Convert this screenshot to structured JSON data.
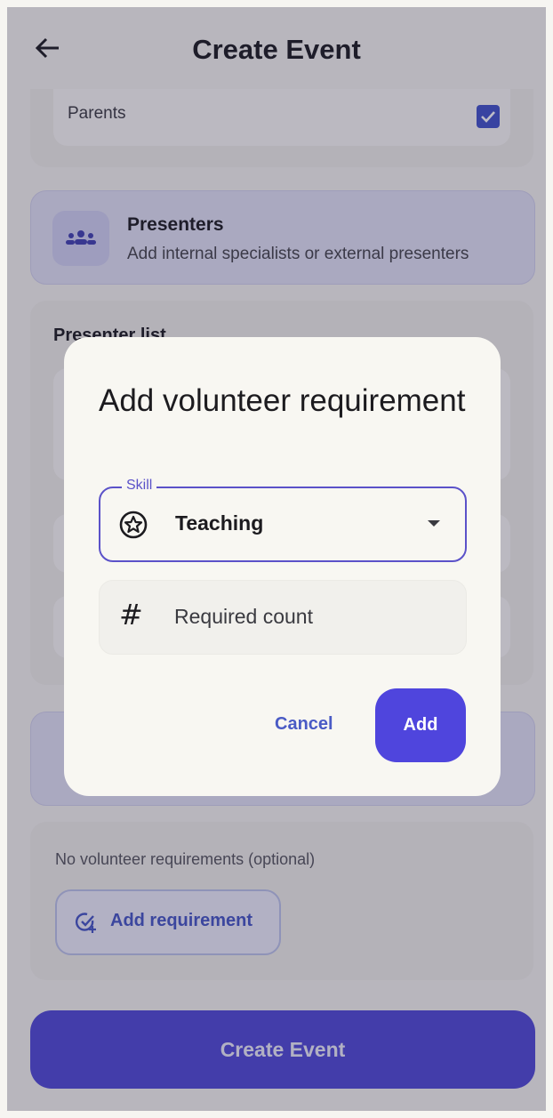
{
  "app_bar": {
    "title": "Create Event",
    "back_icon": "arrow-left-icon"
  },
  "audience": {
    "parents_label": "Parents",
    "parents_checked": true
  },
  "presenters_section": {
    "title": "Presenters",
    "subtitle": "Add internal specialists or external presenters",
    "icon": "groups-icon"
  },
  "presenter_list": {
    "title": "Presenter list"
  },
  "volunteers": {
    "empty_text": "No volunteer requirements (optional)",
    "add_button_label": "Add requirement",
    "add_button_icon": "add-task-icon"
  },
  "footer": {
    "create_label": "Create Event"
  },
  "dialog": {
    "title": "Add volunteer requirement",
    "skill_field": {
      "label": "Skill",
      "value": "Teaching",
      "icon": "star-badge-icon"
    },
    "count_field": {
      "placeholder": "Required count",
      "icon": "hash-icon"
    },
    "cancel_label": "Cancel",
    "add_label": "Add"
  },
  "colors": {
    "primary": "#4f45dd",
    "accent_text": "#4a5bc5",
    "dialog_bg": "#f8f7f2"
  }
}
